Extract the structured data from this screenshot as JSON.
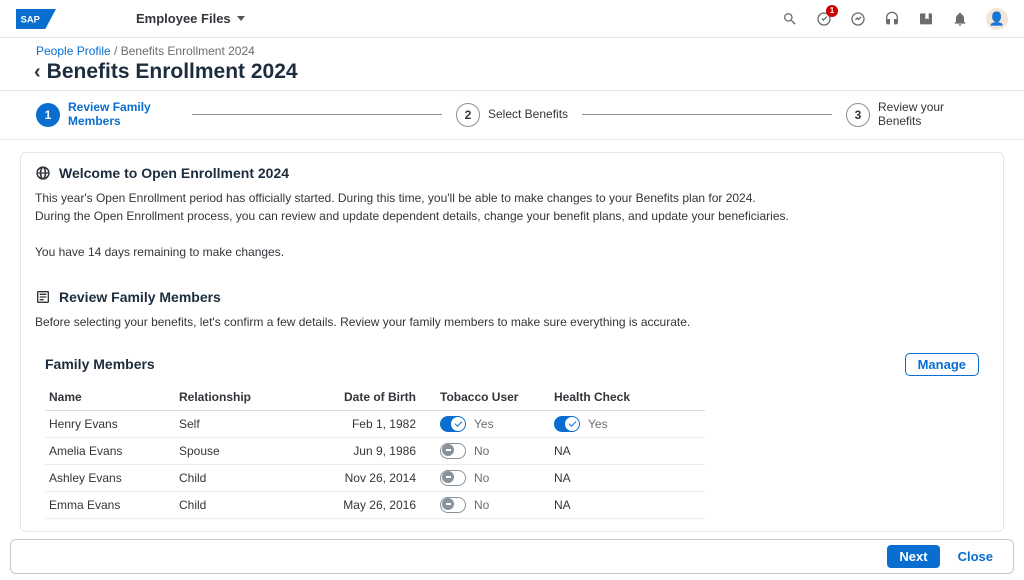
{
  "header": {
    "module": "Employee Files",
    "notificationCount": "1"
  },
  "breadcrumb": {
    "link": "People Profile",
    "sep": " / ",
    "current": "Benefits Enrollment 2024"
  },
  "pageTitle": "Benefits Enrollment 2024",
  "stepper": {
    "steps": [
      {
        "num": "1",
        "label": "Review Family Members"
      },
      {
        "num": "2",
        "label": "Select Benefits"
      },
      {
        "num": "3",
        "label": "Review your Benefits"
      }
    ]
  },
  "welcome": {
    "title": "Welcome to Open Enrollment 2024",
    "line1": "This year's Open Enrollment period has officially started. During this time, you'll be able to make changes to your Benefits plan for 2024.",
    "line2": "During the Open Enrollment process, you can review and update dependent details, change your benefit plans, and update your beneficiaries.",
    "line3": "You have 14 days remaining to make changes."
  },
  "review": {
    "title": "Review Family Members",
    "body": "Before selecting your benefits, let's confirm a few details. Review your family members to make sure everything is accurate."
  },
  "family": {
    "title": "Family Members",
    "manage": "Manage",
    "columns": {
      "name": "Name",
      "relationship": "Relationship",
      "dob": "Date of Birth",
      "tobacco": "Tobacco User",
      "health": "Health Check"
    },
    "rows": [
      {
        "name": "Henry Evans",
        "relationship": "Self",
        "dob": "Feb 1, 1982",
        "tobacco": {
          "on": true,
          "label": "Yes"
        },
        "health": {
          "type": "switch",
          "on": true,
          "label": "Yes"
        }
      },
      {
        "name": "Amelia Evans",
        "relationship": "Spouse",
        "dob": "Jun 9, 1986",
        "tobacco": {
          "on": false,
          "label": "No"
        },
        "health": {
          "type": "text",
          "label": "NA"
        }
      },
      {
        "name": "Ashley Evans",
        "relationship": "Child",
        "dob": "Nov 26, 2014",
        "tobacco": {
          "on": false,
          "label": "No"
        },
        "health": {
          "type": "text",
          "label": "NA"
        }
      },
      {
        "name": "Emma Evans",
        "relationship": "Child",
        "dob": "May 26, 2016",
        "tobacco": {
          "on": false,
          "label": "No"
        },
        "health": {
          "type": "text",
          "label": "NA"
        }
      }
    ]
  },
  "footer": {
    "next": "Next",
    "close": "Close"
  }
}
